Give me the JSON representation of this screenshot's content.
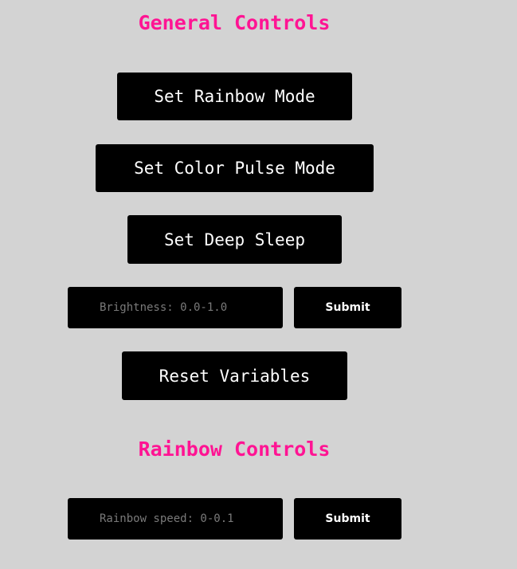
{
  "general": {
    "heading": "General Controls",
    "rainbow_mode_label": "Set Rainbow Mode",
    "color_pulse_label": "Set Color Pulse Mode",
    "deep_sleep_label": "Set Deep Sleep",
    "brightness": {
      "placeholder": "Brightness: 0.0-1.0",
      "value": "",
      "submit_label": "Submit"
    },
    "reset_label": "Reset Variables"
  },
  "rainbow": {
    "heading": "Rainbow Controls",
    "speed": {
      "placeholder": "Rainbow speed: 0-0.1",
      "value": "",
      "submit_label": "Submit"
    }
  },
  "colors": {
    "background": "#d3d3d3",
    "heading": "#ff1493",
    "button_bg": "#000000",
    "button_text": "#ffffff",
    "placeholder_text": "#7a7a7a"
  }
}
